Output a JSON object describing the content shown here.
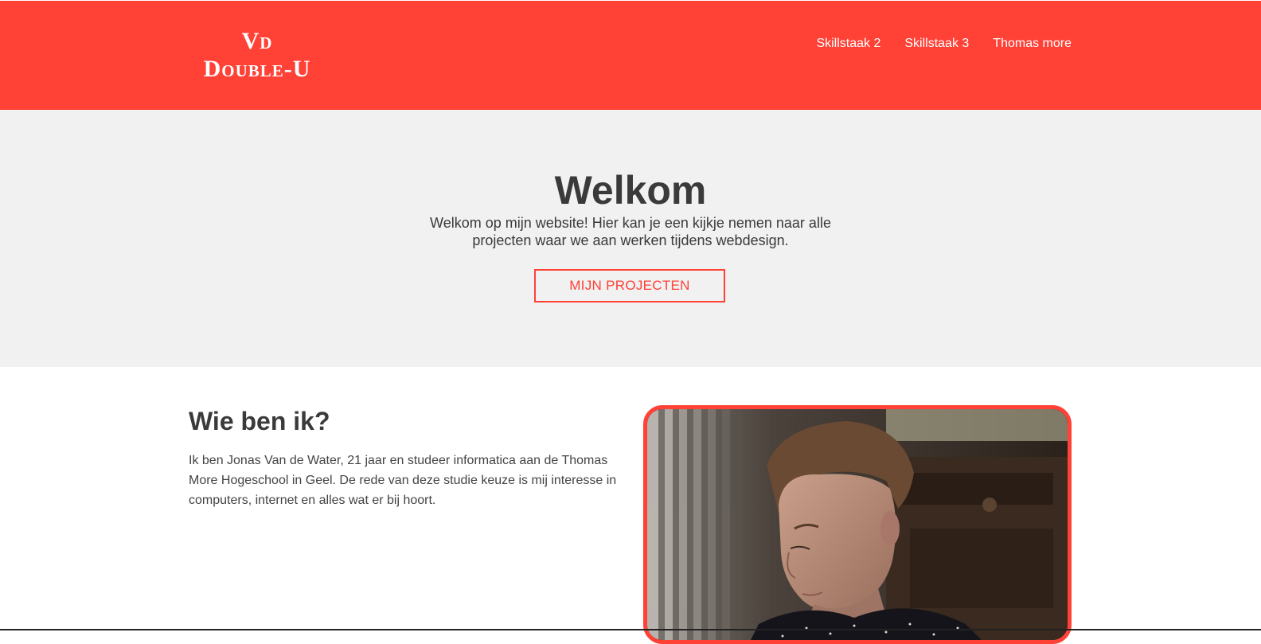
{
  "header": {
    "logo_line1": "Vd",
    "logo_line2": "Double-U",
    "nav": [
      {
        "label": "Skillstaak 2"
      },
      {
        "label": "Skillstaak 3"
      },
      {
        "label": "Thomas more"
      }
    ]
  },
  "hero": {
    "title": "Welkom",
    "text": "Welkom op mijn website! Hier kan je een kijkje nemen naar alle projecten waar we aan werken tijdens webdesign.",
    "button_label": "MIJN PROJECTEN"
  },
  "about": {
    "title": "Wie ben ik?",
    "text": "Ik ben Jonas Van de Water, 21 jaar en studeer informatica aan de Thomas More Hogeschool in Geel. De rede van deze studie keuze is mij interesse in computers, internet en alles wat er bij hoort."
  },
  "colors": {
    "accent": "#ff4136",
    "hero_bg": "#f1f1f1",
    "text": "#3a3a3a"
  }
}
